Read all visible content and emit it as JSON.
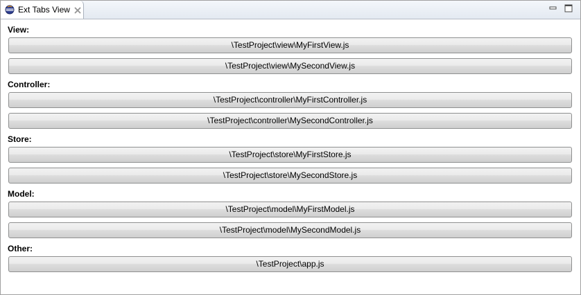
{
  "window": {
    "tab_title": "Ext Tabs View"
  },
  "sections": [
    {
      "label": "View:",
      "files": [
        "\\TestProject\\view\\MyFirstView.js",
        "\\TestProject\\view\\MySecondView.js"
      ]
    },
    {
      "label": "Controller:",
      "files": [
        "\\TestProject\\controller\\MyFirstController.js",
        "\\TestProject\\controller\\MySecondController.js"
      ]
    },
    {
      "label": "Store:",
      "files": [
        "\\TestProject\\store\\MyFirstStore.js",
        "\\TestProject\\store\\MySecondStore.js"
      ]
    },
    {
      "label": "Model:",
      "files": [
        "\\TestProject\\model\\MyFirstModel.js",
        "\\TestProject\\model\\MySecondModel.js"
      ]
    },
    {
      "label": "Other:",
      "files": [
        "\\TestProject\\app.js"
      ]
    }
  ],
  "icons": {
    "tab": "eclipse-view-icon",
    "close": "close-icon",
    "minimize": "minimize-icon",
    "maximize": "maximize-icon"
  },
  "colors": {
    "accent": "#3a4fa0"
  }
}
